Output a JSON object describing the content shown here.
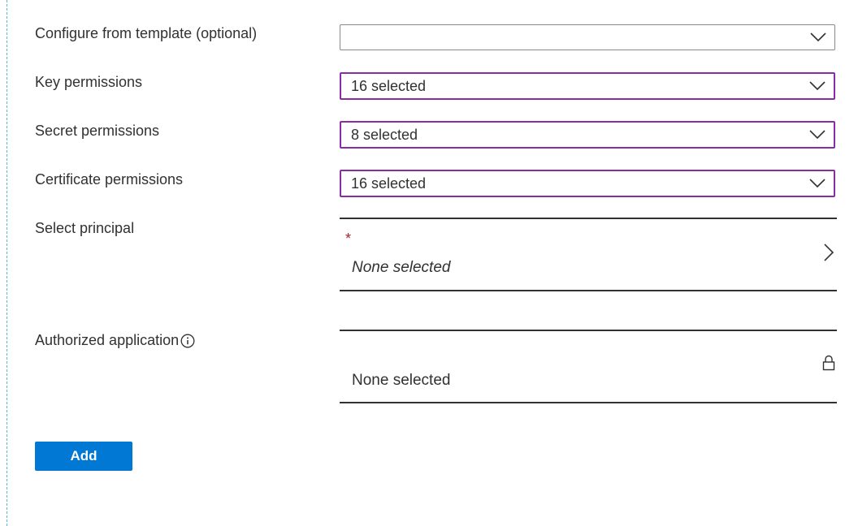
{
  "form": {
    "template": {
      "label": "Configure from template (optional)",
      "value": ""
    },
    "key_permissions": {
      "label": "Key permissions",
      "value": "16 selected"
    },
    "secret_permissions": {
      "label": "Secret permissions",
      "value": "8 selected"
    },
    "certificate_permissions": {
      "label": "Certificate permissions",
      "value": "16 selected"
    },
    "principal": {
      "label": "Select principal",
      "required_marker": "*",
      "value": "None selected"
    },
    "authorized_application": {
      "label": "Authorized application",
      "value": "None selected"
    },
    "add_label": "Add"
  },
  "icons": {
    "dropdown": "chevron-down-icon",
    "principal_picker": "chevron-right-icon",
    "authorized_application_locked": "lock-icon",
    "authorized_application_info": "info-icon"
  },
  "colors": {
    "focus_border": "#8a2da5",
    "primary_button": "#0078d4",
    "required": "#a4262c"
  }
}
